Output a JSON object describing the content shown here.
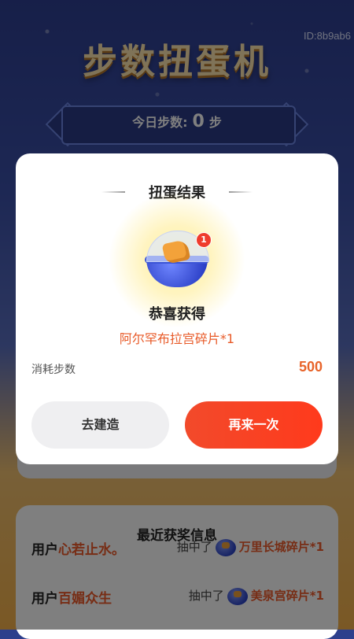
{
  "background": {
    "game_id": "ID:8b9ab6",
    "title": "步数扭蛋机",
    "steps_banner": {
      "label": "今日步数:",
      "value": "0",
      "unit": "步"
    }
  },
  "recent_wins": {
    "title": "最近获奖信息",
    "rows": [
      {
        "prefix": "用户",
        "user": "心若止水。",
        "action": "抽中了",
        "prize": "万里长城碎片*1"
      },
      {
        "prefix": "用户",
        "user": "百媚众生",
        "action": "抽中了",
        "prize": "美泉宫碎片*1"
      }
    ]
  },
  "dialog": {
    "title": "扭蛋结果",
    "badge_count": "1",
    "congrats": "恭喜获得",
    "prize": "阿尔罕布拉宫碎片*1",
    "cost_label": "消耗步数",
    "cost_value": "500",
    "build_button": "去建造",
    "again_button": "再来一次"
  },
  "colors": {
    "accent": "#ef3b2c",
    "prize_text": "#e85a28",
    "primary_button": "#f24a2b",
    "secondary_button": "#efeff1"
  }
}
